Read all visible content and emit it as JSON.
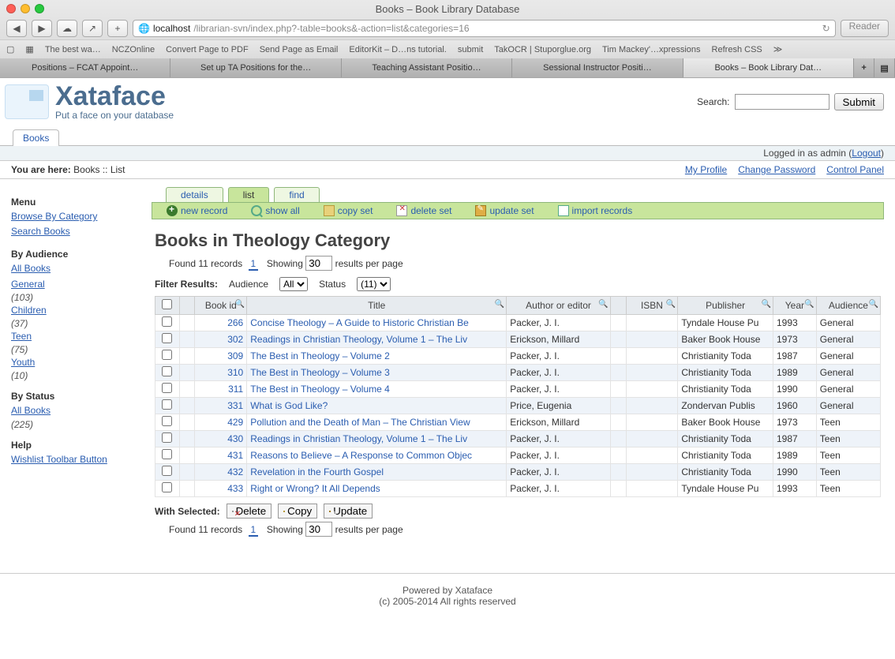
{
  "window": {
    "title": "Books – Book Library Database"
  },
  "nav": {
    "back": "◀",
    "fwd": "▶",
    "cloud": "☁",
    "share": "↗",
    "add": "+",
    "url_host": "localhost",
    "url_path": "/librarian-svn/index.php?-table=books&-action=list&categories=16",
    "reload": "↻",
    "reader": "Reader"
  },
  "bookmarks": [
    "▢",
    "▦",
    "The best wa…",
    "NCZOnline",
    "Convert Page to PDF",
    "Send Page as Email",
    "EditorKit – D…ns tutorial.",
    "submit",
    "TakOCR | Stuporglue.org",
    "Tim Mackey'…xpressions",
    "Refresh CSS",
    "≫"
  ],
  "browser_tabs": [
    {
      "label": "Positions – FCAT Appoint…"
    },
    {
      "label": "Set up TA Positions for the…"
    },
    {
      "label": "Teaching Assistant Positio…"
    },
    {
      "label": "Sessional Instructor Positi…"
    },
    {
      "label": "Books – Book Library Dat…",
      "active": true
    }
  ],
  "brand": {
    "name": "Xataface",
    "tag": "Put a face on your database"
  },
  "search": {
    "label": "Search:",
    "button": "Submit"
  },
  "top_tabs": [
    {
      "label": "Books",
      "active": true
    }
  ],
  "login_status": {
    "text": "Logged in as admin (",
    "link": "Logout",
    "suffix": ")"
  },
  "breadcrumb": {
    "prefix": "You are here:",
    "path": "Books :: List",
    "right": [
      "My Profile",
      "Change Password",
      "Control Panel"
    ]
  },
  "sidebar": {
    "menu_h": "Menu",
    "menu": [
      "Browse By Category",
      "Search Books"
    ],
    "aud_h": "By Audience",
    "aud": [
      {
        "label": "All Books",
        "count": ""
      },
      {
        "label": "General",
        "count": "(103)"
      },
      {
        "label": "Children",
        "count": "(37)"
      },
      {
        "label": "Teen",
        "count": "(75)"
      },
      {
        "label": "Youth",
        "count": "(10)"
      }
    ],
    "stat_h": "By Status",
    "stat": [
      {
        "label": "All Books",
        "count": ""
      },
      {
        "label": "",
        "count": "(225)"
      }
    ],
    "help_h": "Help",
    "help": [
      "Wishlist Toolbar Button"
    ]
  },
  "view_tabs": [
    {
      "label": "details"
    },
    {
      "label": "list",
      "active": true
    },
    {
      "label": "find"
    }
  ],
  "actions": [
    {
      "label": "new record",
      "icon": "plus"
    },
    {
      "label": "show all",
      "icon": "mag"
    },
    {
      "label": "copy set",
      "icon": "copy"
    },
    {
      "label": "delete set",
      "icon": "del"
    },
    {
      "label": "update set",
      "icon": "upd"
    },
    {
      "label": "import records",
      "icon": "imp"
    }
  ],
  "page": {
    "title": "Books in Theology Category",
    "found": "Found 11 records",
    "page": "1",
    "showing": "Showing",
    "per": "30",
    "pp": "results per page",
    "filter_label": "Filter Results:",
    "aud_label": "Audience",
    "aud_val": "All",
    "stat_label": "Status",
    "stat_val": "(11)"
  },
  "columns": [
    "",
    "",
    "Book id",
    "Title",
    "Author or editor",
    "",
    "ISBN",
    "Publisher",
    "Year",
    "Audience"
  ],
  "rows": [
    {
      "id": "266",
      "title": "Concise Theology – A Guide to Historic Christian Be",
      "author": "Packer, J. I.",
      "pub": "Tyndale House Pu",
      "year": "1993",
      "aud": "General"
    },
    {
      "id": "302",
      "title": "Readings in Christian Theology, Volume 1 – The Liv",
      "author": "Erickson, Millard",
      "pub": "Baker Book House",
      "year": "1973",
      "aud": "General"
    },
    {
      "id": "309",
      "title": "The Best in Theology – Volume 2",
      "author": "Packer, J. I.",
      "pub": "Christianity Toda",
      "year": "1987",
      "aud": "General"
    },
    {
      "id": "310",
      "title": "The Best in Theology – Volume 3",
      "author": "Packer, J. I.",
      "pub": "Christianity Toda",
      "year": "1989",
      "aud": "General"
    },
    {
      "id": "311",
      "title": "The Best in Theology – Volume 4",
      "author": "Packer, J. I.",
      "pub": "Christianity Toda",
      "year": "1990",
      "aud": "General"
    },
    {
      "id": "331",
      "title": "What is God Like?",
      "author": "Price, Eugenia",
      "pub": "Zondervan Publis",
      "year": "1960",
      "aud": "General"
    },
    {
      "id": "429",
      "title": "Pollution and the Death of Man – The Christian View",
      "author": "Erickson, Millard",
      "pub": "Baker Book House",
      "year": "1973",
      "aud": "Teen"
    },
    {
      "id": "430",
      "title": "Readings in Christian Theology, Volume 1 – The Liv",
      "author": "Packer, J. I.",
      "pub": "Christianity Toda",
      "year": "1987",
      "aud": "Teen"
    },
    {
      "id": "431",
      "title": "Reasons to Believe – A Response to Common Objec",
      "author": "Packer, J. I.",
      "pub": "Christianity Toda",
      "year": "1989",
      "aud": "Teen"
    },
    {
      "id": "432",
      "title": "Revelation in the Fourth Gospel",
      "author": "Packer, J. I.",
      "pub": "Christianity Toda",
      "year": "1990",
      "aud": "Teen"
    },
    {
      "id": "433",
      "title": "Right or Wrong? It All Depends",
      "author": "Packer, J. I.",
      "pub": "Tyndale House Pu",
      "year": "1993",
      "aud": "Teen"
    }
  ],
  "withsel": {
    "label": "With Selected:",
    "delete": "Delete",
    "copy": "Copy",
    "update": "Update"
  },
  "footer": {
    "l1": "Powered by Xataface",
    "l2": "(c) 2005-2014 All rights reserved"
  }
}
